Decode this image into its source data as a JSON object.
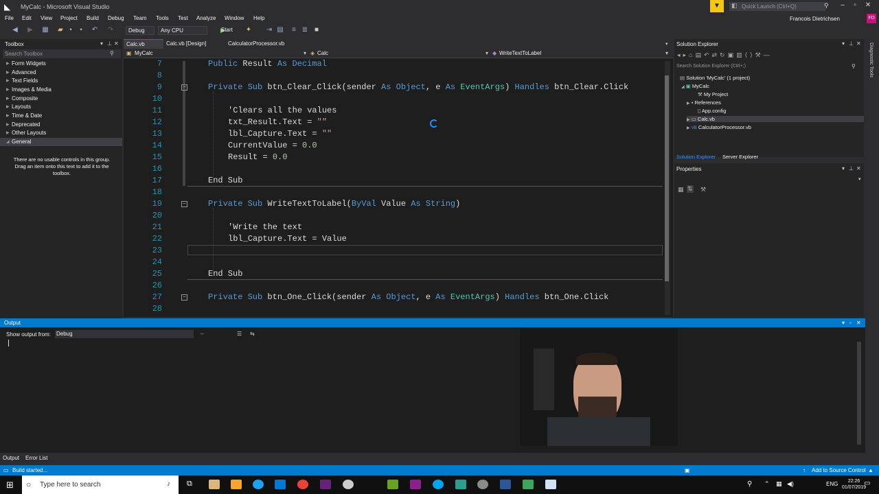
{
  "window": {
    "title": "MyCalc - Microsoft Visual Studio",
    "quick_launch_placeholder": "Quick Launch (Ctrl+Q)",
    "user_name": "Francois Dietrichsen",
    "user_initials": "FD"
  },
  "menu": [
    "File",
    "Edit",
    "View",
    "Project",
    "Build",
    "Debug",
    "Team",
    "Tools",
    "Test",
    "Analyze",
    "Window",
    "Help"
  ],
  "toolbar": {
    "config": "Debug",
    "platform": "Any CPU",
    "start_label": "Start"
  },
  "toolbox": {
    "title": "Toolbox",
    "search_placeholder": "Search Toolbox",
    "categories": [
      "Form Widgets",
      "Advanced",
      "Text Fields",
      "Images & Media",
      "Composite",
      "Layouts",
      "Time & Date",
      "Deprecated",
      "Other Layouts",
      "General"
    ],
    "empty_note": "There are no usable controls in this group. Drag an item onto this text to add it to the toolbox."
  },
  "editor": {
    "tabs": [
      "Calc.vb",
      "Calc.vb [Design]",
      "CalculatorProcessor.vb"
    ],
    "nav": {
      "project": "MyCalc",
      "class": "Calc",
      "member": "WriteTextToLabel"
    },
    "line_numbers": [
      "7",
      "8",
      "9",
      "10",
      "11",
      "12",
      "13",
      "14",
      "15",
      "16",
      "17",
      "18",
      "19",
      "20",
      "21",
      "22",
      "23",
      "24",
      "25",
      "26",
      "27",
      "28"
    ],
    "code": {
      "l7_a": "Public",
      "l7_b": " Result ",
      "l7_c": "As",
      "l7_d": "Decimal",
      "l9_a": "Private Sub",
      "l9_b": " btn_Clear_Click(sender ",
      "l9_c": "As",
      "l9_d": "Object",
      "l9_e": ", e ",
      "l9_f": "As",
      "l9_g": "EventArgs",
      "l9_h": ") ",
      "l9_i": "Handles",
      "l9_j": " btn_Clear.Click",
      "l11": "'Clears all the values",
      "l12_a": "txt_Result.Text = ",
      "l12_b": "\"\"",
      "l13_a": "lbl_Capture.Text = ",
      "l13_b": "\"\"",
      "l14_a": "CurrentValue = ",
      "l14_b": "0.0",
      "l15_a": "Result = ",
      "l15_b": "0.0",
      "l17": "End Sub",
      "l19_a": "Private Sub",
      "l19_b": " WriteTextToLabel(",
      "l19_c": "ByVal",
      "l19_d": " Value ",
      "l19_e": "As",
      "l19_f": "String",
      "l19_g": ")",
      "l21": "'Write the text",
      "l22": "lbl_Capture.Text = Value",
      "l25": "End Sub",
      "l27_a": "Private Sub",
      "l27_b": " btn_One_Click(sender ",
      "l27_c": "As",
      "l27_d": "Object",
      "l27_e": ", e ",
      "l27_f": "As",
      "l27_g": "EventArgs",
      "l27_h": ") ",
      "l27_i": "Handles",
      "l27_j": " btn_One.Click"
    }
  },
  "solution_explorer": {
    "title": "Solution Explorer",
    "search_placeholder": "Search Solution Explorer (Ctrl+;)",
    "items": [
      "Solution 'MyCalc' (1 project)",
      "MyCalc",
      "My Project",
      "References",
      "App.config",
      "Calc.vb",
      "CalculatorProcessor.vb"
    ],
    "tabs": [
      "Solution Explorer",
      "Server Explorer"
    ]
  },
  "properties": {
    "title": "Properties"
  },
  "output": {
    "title": "Output",
    "show_from_label": "Show output from:",
    "source": "Debug"
  },
  "bottom_tabs": [
    "Output",
    "Error List"
  ],
  "status": {
    "message": "Build started...",
    "source_control": "Add to Source Control"
  },
  "taskbar": {
    "search_placeholder": "Type here to search",
    "language": "ENG",
    "time": "22:26",
    "date": "01/07/2019"
  },
  "colors": {
    "accent": "#007acc",
    "keyword": "#569cd6",
    "type": "#4ec9b0",
    "comment": "#57a64a",
    "string": "#d69d85"
  }
}
